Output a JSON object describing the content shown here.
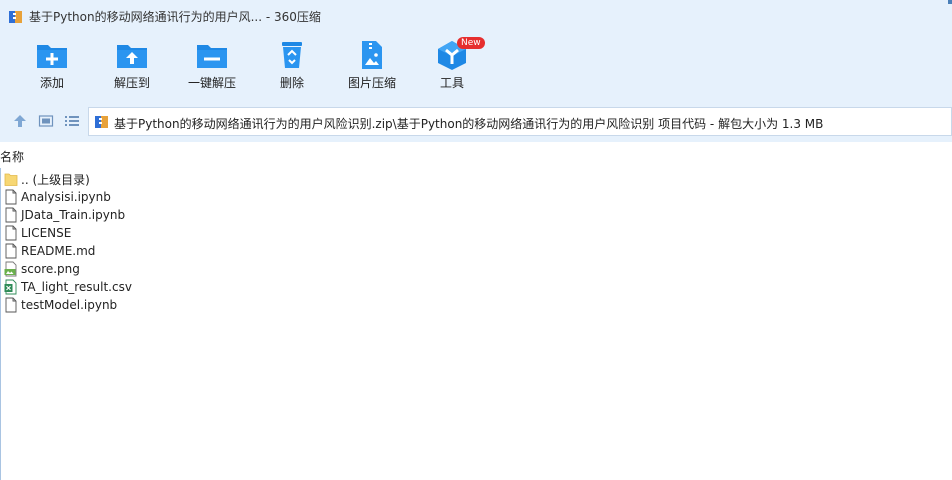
{
  "window": {
    "title": "基于Python的移动网络通讯行为的用户风... - 360压缩",
    "app_icon": "archive-icon"
  },
  "toolbar": {
    "items": [
      {
        "label": "添加",
        "icon": "folder-add-icon"
      },
      {
        "label": "解压到",
        "icon": "folder-extract-icon"
      },
      {
        "label": "一键解压",
        "icon": "folder-oneclick-icon"
      },
      {
        "label": "删除",
        "icon": "recycle-bin-icon"
      },
      {
        "label": "图片压缩",
        "icon": "image-zip-icon"
      },
      {
        "label": "工具",
        "icon": "tools-cube-icon",
        "badge": "New"
      }
    ]
  },
  "address": {
    "path": "基于Python的移动网络通讯行为的用户风险识别.zip\\基于Python的移动网络通讯行为的用户风险识别 项目代码 - 解包大小为 1.3 MB",
    "nav_icons": [
      "up-arrow-icon",
      "view-icon",
      "list-view-icon"
    ]
  },
  "file_list": {
    "column_header": "名称",
    "items": [
      {
        "name": ".. (上级目录)",
        "icon": "folder"
      },
      {
        "name": "Analysisi.ipynb",
        "icon": "doc"
      },
      {
        "name": "JData_Train.ipynb",
        "icon": "doc"
      },
      {
        "name": "LICENSE",
        "icon": "doc"
      },
      {
        "name": "README.md",
        "icon": "doc"
      },
      {
        "name": "score.png",
        "icon": "png"
      },
      {
        "name": "TA_light_result.csv",
        "icon": "csv"
      },
      {
        "name": "testModel.ipynb",
        "icon": "doc"
      }
    ]
  },
  "colors": {
    "toolbar_bg": "#e6f1fc",
    "icon_blue": "#1e88e5",
    "badge_red": "#e62e2e"
  }
}
